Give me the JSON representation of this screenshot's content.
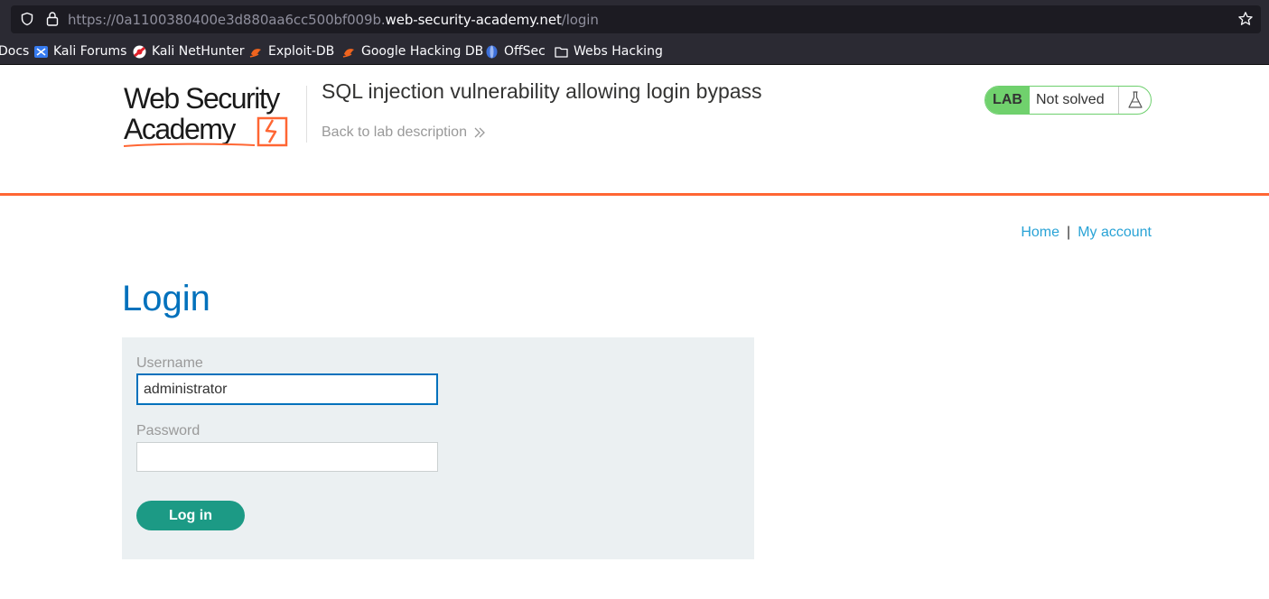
{
  "browser": {
    "url_prefix": "https://0a1100380400e3d880aa6cc500bf009b.",
    "url_host": "web-security-academy.net",
    "url_path": "/login",
    "bookmarks": [
      {
        "label": "Docs",
        "icon": "docs-icon"
      },
      {
        "label": "Kali Forums",
        "icon": "kali-forums-icon"
      },
      {
        "label": "Kali NetHunter",
        "icon": "kali-nethunter-icon"
      },
      {
        "label": "Exploit-DB",
        "icon": "exploit-db-icon"
      },
      {
        "label": "Google Hacking DB",
        "icon": "ghdb-icon"
      },
      {
        "label": "OffSec",
        "icon": "offsec-icon"
      },
      {
        "label": "Webs Hacking",
        "icon": "folder-icon"
      }
    ]
  },
  "lab": {
    "logo_line1": "Web Security",
    "logo_line2": "Academy",
    "title": "SQL injection vulnerability allowing login bypass",
    "back_link": "Back to lab description",
    "badge_label": "LAB",
    "status": "Not solved"
  },
  "nav": {
    "home": "Home",
    "separator": "|",
    "my_account": "My account"
  },
  "login": {
    "title": "Login",
    "username_label": "Username",
    "username_value": "administrator",
    "password_label": "Password",
    "password_value": "",
    "submit_label": "Log in"
  },
  "colors": {
    "accent_blue": "#0071bc",
    "link_blue": "#29a3d6",
    "orange": "#ff6633",
    "button_teal": "#1c9a85",
    "lab_green": "#70d16d"
  }
}
